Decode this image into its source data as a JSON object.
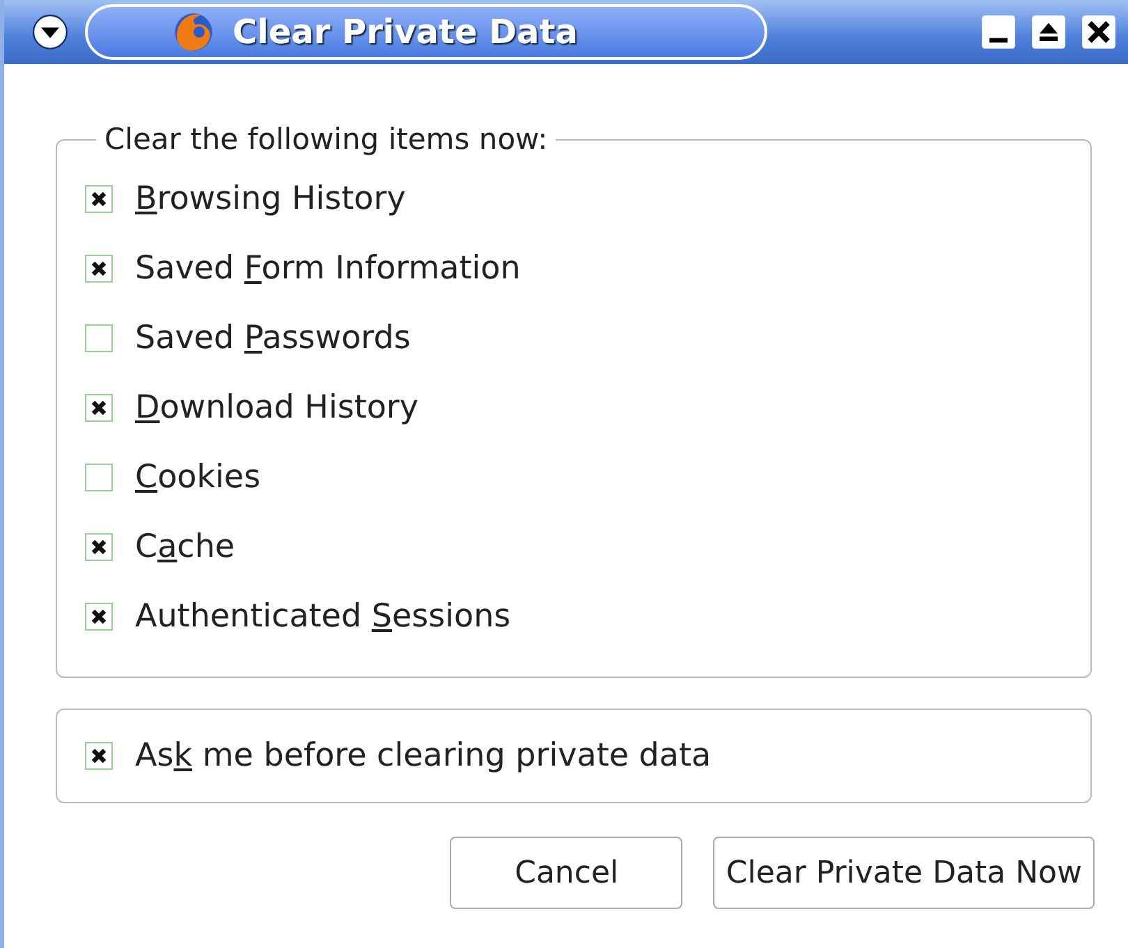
{
  "window": {
    "title": "Clear Private Data"
  },
  "group": {
    "legend": "Clear the following items now:",
    "items": [
      {
        "key": "B",
        "after": "rowsing History",
        "checked": true
      },
      {
        "before": "Saved ",
        "key": "F",
        "after": "orm Information",
        "checked": true
      },
      {
        "before": "Saved ",
        "key": "P",
        "after": "asswords",
        "checked": false
      },
      {
        "key": "D",
        "after": "ownload History",
        "checked": true
      },
      {
        "key": "C",
        "after": "ookies",
        "checked": false
      },
      {
        "before": "C",
        "key": "a",
        "after": "che",
        "checked": true
      },
      {
        "before": "Authenticated ",
        "key": "S",
        "after": "essions",
        "checked": true
      }
    ]
  },
  "ask": {
    "before": "As",
    "key": "k",
    "after": " me before clearing private data",
    "checked": true
  },
  "buttons": [
    "Cancel",
    "Clear Private Data Now"
  ]
}
